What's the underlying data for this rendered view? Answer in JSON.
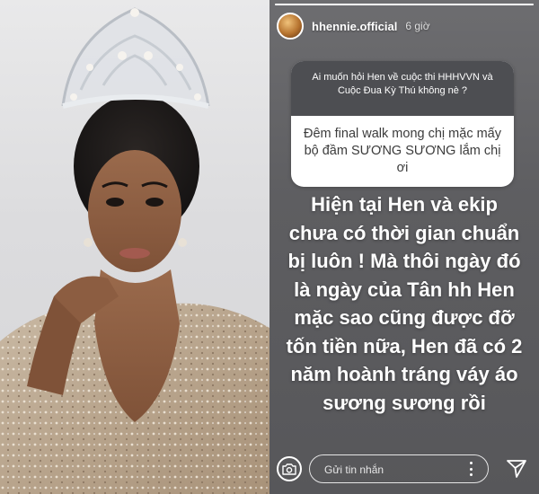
{
  "story": {
    "username": "hhennie.official",
    "time": "6 giờ",
    "progress": 1.0,
    "question": {
      "prompt": "Ai muốn hỏi Hen về cuộc thi HHHVVN và Cuộc Đua Kỳ Thú không nè ?",
      "answer": "Đêm final walk mong chị mặc mấy bộ đầm SƯƠNG SƯƠNG lắm chị ơi"
    },
    "reply": "Hiện tại Hen  và ekip\nchưa có thời gian chuẩn\nbị luôn ! Mà thôi ngày đó\nlà ngày của Tân hh Hen\nmặc sao cũng được đỡ\ntốn tiền nữa, Hen đã có 2\nnăm hoành tráng váy áo\nsương sương rồi",
    "footer": {
      "message_placeholder": "Gửi tin nhắn",
      "camera_icon": "camera-icon",
      "more_icon": "more-vertical-icon",
      "send_icon": "send-icon"
    }
  },
  "colors": {
    "story_bg": "#5e5e61",
    "question_header_bg": "#4d4e52",
    "question_body_bg": "#ffffff",
    "text_white": "#ffffff"
  }
}
